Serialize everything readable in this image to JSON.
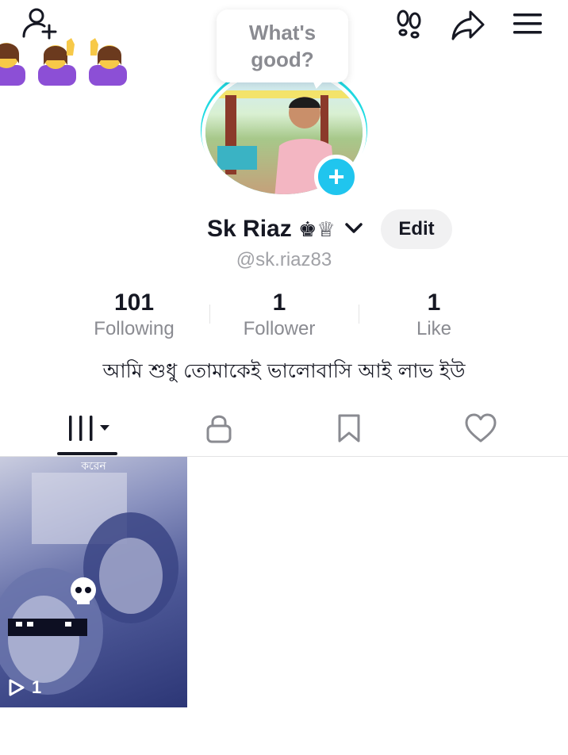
{
  "top_bar": {
    "add_friend_icon": "person-plus-icon",
    "footprints_icon": "footprints-icon",
    "share_icon": "share-arrow-icon",
    "menu_icon": "hamburger-menu-icon"
  },
  "status_bubble": {
    "text": "What's good?"
  },
  "profile": {
    "name": "Sk Riaz",
    "name_symbols": "♚♕",
    "handle": "@sk.riaz83",
    "edit_label": "Edit",
    "bio": "আমি শুধু তোমাকেই ভালোবাসি আই লাভ ইউ"
  },
  "stats": [
    {
      "value": "101",
      "label": "Following"
    },
    {
      "value": "1",
      "label": "Follower"
    },
    {
      "value": "1",
      "label": "Like"
    }
  ],
  "tabs": [
    {
      "icon": "grid-videos-icon",
      "active": true
    },
    {
      "icon": "lock-icon",
      "active": false
    },
    {
      "icon": "bookmark-icon",
      "active": false
    },
    {
      "icon": "heart-icon",
      "active": false
    }
  ],
  "videos": [
    {
      "caption": "করেন",
      "play_count": "1"
    }
  ],
  "colors": {
    "accent": "#20c5ee",
    "ring": "#25f4ee",
    "text_primary": "#161823",
    "text_secondary": "#8a8b91"
  }
}
